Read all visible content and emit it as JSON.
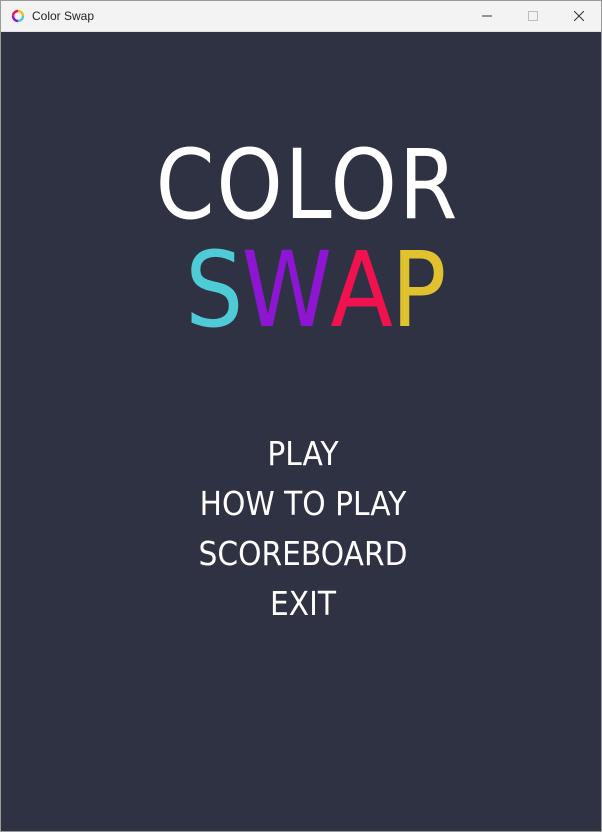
{
  "window": {
    "title": "Color Swap",
    "app_icon": "color-ring-icon",
    "controls": [
      "minimize-icon",
      "maximize-icon",
      "close-icon"
    ]
  },
  "colors": {
    "background": "#2f3242",
    "text": "#ffffff",
    "cyan": "#4fcbd7",
    "purple": "#8c16d1",
    "magenta": "#f0114f",
    "yellow": "#e0c22f"
  },
  "logo": {
    "line1": "COLOR",
    "line2": [
      {
        "char": "S",
        "color": "#4fcbd7"
      },
      {
        "char": "W",
        "color": "#8c16d1"
      },
      {
        "char": "A",
        "color": "#f0114f"
      },
      {
        "char": "P",
        "color": "#e0c22f"
      }
    ]
  },
  "menu": {
    "items": [
      "PLAY",
      "HOW TO PLAY",
      "SCOREBOARD",
      "EXIT"
    ]
  }
}
